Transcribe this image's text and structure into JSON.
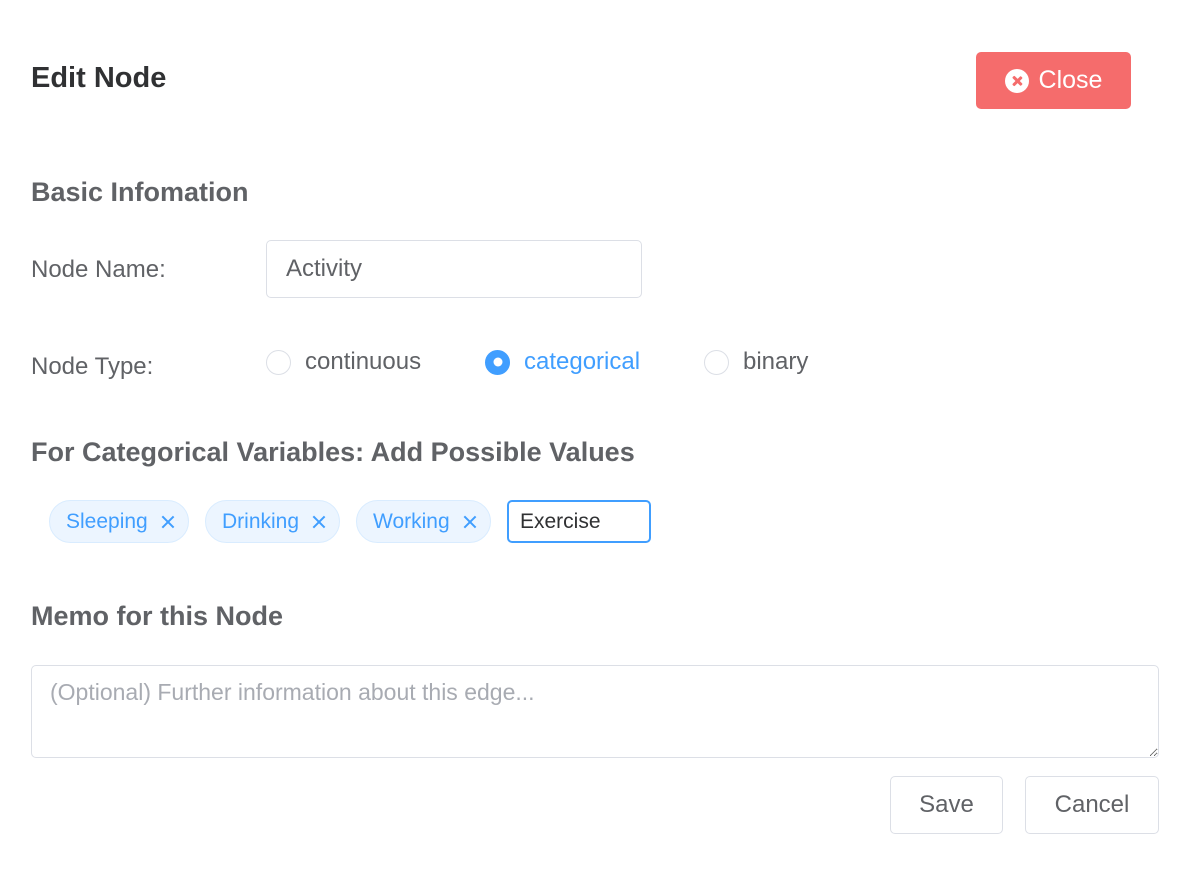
{
  "dialog": {
    "title": "Edit Node",
    "close_label": "Close"
  },
  "basic": {
    "section_title": "Basic Infomation",
    "name_label": "Node Name:",
    "name_value": "Activity",
    "type_label": "Node Type:",
    "type_options": [
      "continuous",
      "categorical",
      "binary"
    ],
    "type_selected": "categorical"
  },
  "categorical": {
    "section_title": "For Categorical Variables: Add Possible Values",
    "tags": [
      "Sleeping",
      "Drinking",
      "Working"
    ],
    "input_value": "Exercise"
  },
  "memo": {
    "section_title": "Memo for this Node",
    "placeholder": "(Optional) Further information about this edge..."
  },
  "actions": {
    "save_label": "Save",
    "cancel_label": "Cancel"
  },
  "colors": {
    "primary": "#409eff",
    "danger": "#f56c6c",
    "text": "#606266",
    "border": "#dcdfe6"
  }
}
